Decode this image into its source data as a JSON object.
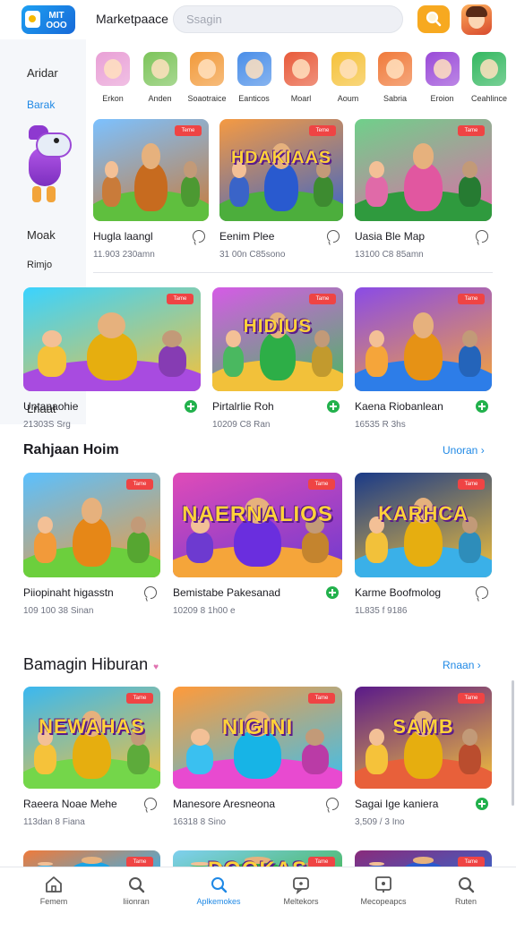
{
  "header": {
    "logo_text": "MIT\nOOO",
    "app_title": "Marketpaace",
    "search_placeholder": "Ssagin"
  },
  "sidebar": {
    "items": [
      {
        "label": "Aridar",
        "active": false
      },
      {
        "label": "Barak",
        "active": true
      },
      {
        "label": "Moak",
        "active": false
      },
      {
        "label": "Rimjo",
        "active": false
      },
      {
        "label": "Lnaat",
        "active": false
      }
    ]
  },
  "categories": [
    {
      "label": "Erkon",
      "color": "#e9a0d6",
      "icon": "game-category-icon"
    },
    {
      "label": "Anden",
      "color": "#7cc45a",
      "icon": "game-category-icon"
    },
    {
      "label": "Soaotraice",
      "color": "#f29a3a",
      "icon": "game-category-icon"
    },
    {
      "label": "Eanticos",
      "color": "#4a8ee8",
      "icon": "game-category-icon"
    },
    {
      "label": "Moarl",
      "color": "#e85a3a",
      "icon": "game-category-icon"
    },
    {
      "label": "Aoum",
      "color": "#f5c23a",
      "icon": "game-category-icon"
    },
    {
      "label": "Sabria",
      "color": "#f07a3a",
      "icon": "game-category-icon"
    },
    {
      "label": "Eroion",
      "color": "#9a4ad8",
      "icon": "game-category-icon"
    },
    {
      "label": "Ceahlince",
      "color": "#34b860",
      "icon": "game-category-icon"
    }
  ],
  "row1": [
    {
      "name": "Hugla laangl",
      "meta": "11.903 230amn",
      "badge": "Teme",
      "action": "chat",
      "colors": [
        "#7cc1ff",
        "#5fbf3e",
        "#c97b3a"
      ],
      "headline": ""
    },
    {
      "name": "Eenim Plee",
      "meta": "31 00n C85sono",
      "badge": "Teme",
      "action": "chat",
      "colors": [
        "#f59a42",
        "#4cae3c",
        "#3a64c8"
      ],
      "headline": "HDAKIAAS"
    },
    {
      "name": "Uasia Ble Map",
      "meta": "13100 C8 85amn",
      "badge": "Tame",
      "action": "chat",
      "colors": [
        "#6fd08a",
        "#2f9a3e",
        "#e06aa8"
      ],
      "headline": ""
    }
  ],
  "row2": [
    {
      "name": "Untanaohie",
      "meta": "21303S Srg",
      "badge": "Tame",
      "action": "add",
      "colors": [
        "#3ad3ff",
        "#a84be0",
        "#f5c23a"
      ],
      "headline": ""
    },
    {
      "name": "Pirtalrlie Roh",
      "meta": "10209 C8 Ran",
      "badge": "Tame",
      "action": "add",
      "colors": [
        "#d55be6",
        "#f2c13a",
        "#4ab860"
      ],
      "headline": "HIDIUS"
    },
    {
      "name": "Kaena Riobanlean",
      "meta": "16535 R 3hs",
      "badge": "Tame",
      "action": "add",
      "colors": [
        "#8a4be6",
        "#2d7de8",
        "#f5a53a"
      ],
      "headline": ""
    }
  ],
  "section1": {
    "title": "Rahjaan Hoim",
    "more": "Unoran"
  },
  "row3": [
    {
      "name": "Piiopinaht higasstn",
      "meta": "109 100 38 Sinan",
      "badge": "Tame",
      "action": "chat",
      "colors": [
        "#5ac0ff",
        "#6ccf3d",
        "#f29a3a"
      ],
      "headline": ""
    },
    {
      "name": "Bemistabe Pakesanad",
      "meta": "10209 8 1h00 e",
      "badge": "Tame",
      "action": "add",
      "colors": [
        "#e04bb8",
        "#f5a53a",
        "#6d3ad0"
      ],
      "headline": "NAERNALIOS"
    },
    {
      "name": "Karme Boofmolog",
      "meta": "1L835 f 9186",
      "badge": "Tame",
      "action": "chat",
      "colors": [
        "#1a3a88",
        "#3ab0e8",
        "#f2c13a"
      ],
      "headline": "KARHCA"
    }
  ],
  "section2": {
    "title": "Bamagin Hiburan",
    "more": "Rnaan"
  },
  "row4": [
    {
      "name": "Raeera Noae Mehe",
      "meta": "113dan 8 Fiana",
      "badge": "Tame",
      "action": "chat",
      "colors": [
        "#3ab8f0",
        "#74d64a",
        "#f5c23a"
      ],
      "headline": "NEWAHAS"
    },
    {
      "name": "Manesore Aresneona",
      "meta": "16318 8 Sino",
      "badge": "Tame",
      "action": "chat",
      "colors": [
        "#ff9a3a",
        "#e84ad0",
        "#3ac0f0"
      ],
      "headline": "NIGINI"
    },
    {
      "name": "Sagai Ige kaniera",
      "meta": "3,509 / 3 Ino",
      "badge": "Tame",
      "action": "add",
      "colors": [
        "#5a1a8a",
        "#e8603a",
        "#f5c23a"
      ],
      "headline": "SAMB"
    }
  ],
  "row5": [
    {
      "badge": "Tame",
      "colors": [
        "#f07a3a",
        "#6ccf3d",
        "#3ab0e8"
      ],
      "headline": ""
    },
    {
      "badge": "Tame",
      "colors": [
        "#7fd0f0",
        "#f5c23a",
        "#4ab860"
      ],
      "headline": "DOOKAS"
    },
    {
      "badge": "Tame",
      "colors": [
        "#8a2a7a",
        "#e8603a",
        "#3a64c8"
      ],
      "headline": ""
    }
  ],
  "bottom_nav": [
    {
      "label": "Femem",
      "icon": "home-icon",
      "active": false
    },
    {
      "label": "Iiionran",
      "icon": "search-icon",
      "active": false
    },
    {
      "label": "Aplkemokes",
      "icon": "search-icon",
      "active": true
    },
    {
      "label": "Meltekors",
      "icon": "chat-icon",
      "active": false
    },
    {
      "label": "Mecopeapcs",
      "icon": "pin-icon",
      "active": false
    },
    {
      "label": "Ruten",
      "icon": "search-icon",
      "active": false
    }
  ]
}
